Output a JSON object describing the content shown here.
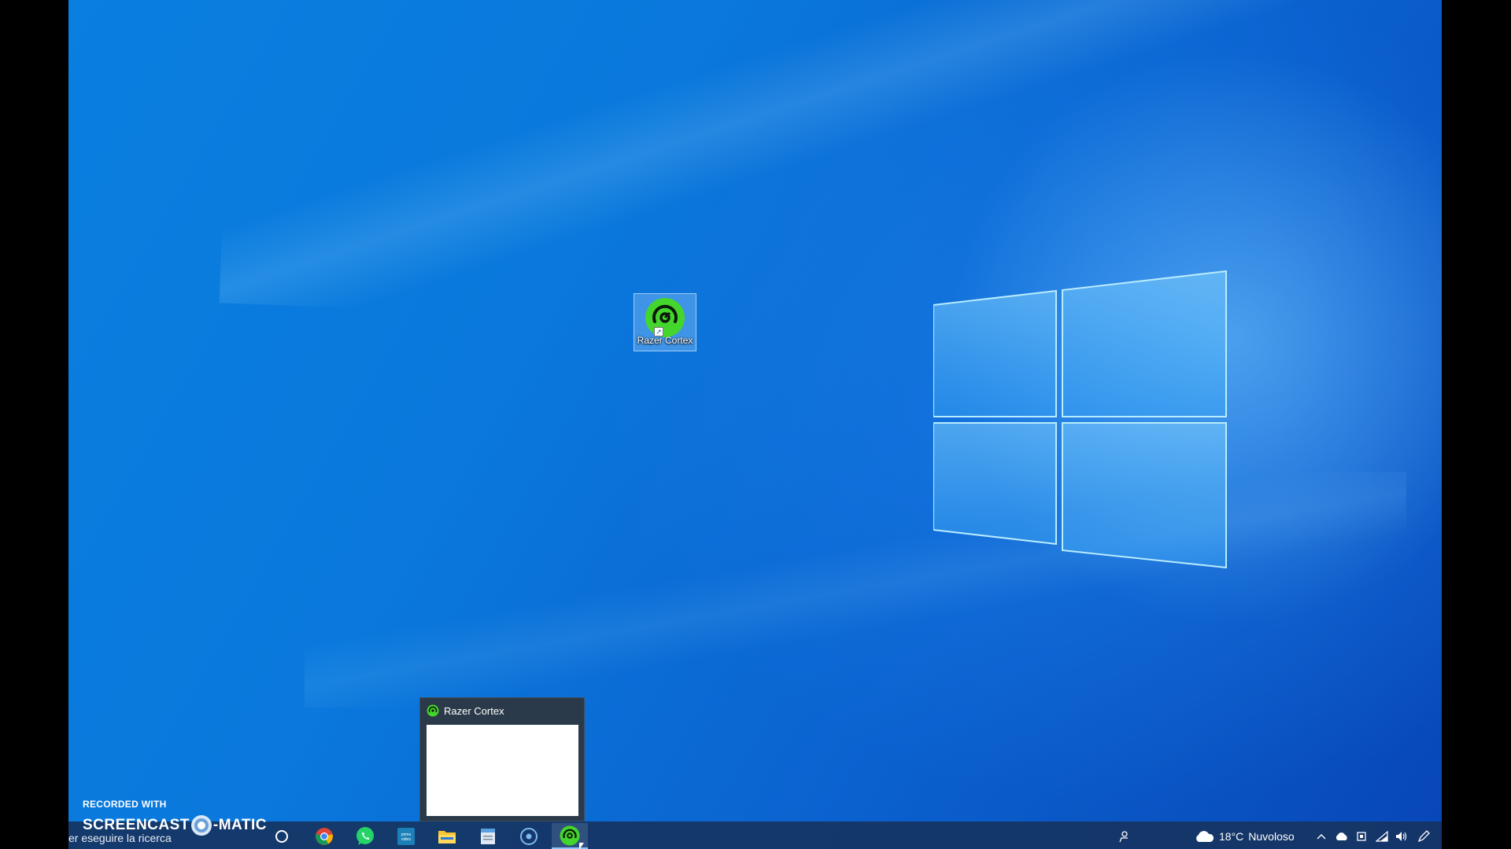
{
  "desktop": {
    "icons": [
      {
        "label": "Razer Cortex",
        "icon": "razer-cortex-icon"
      }
    ]
  },
  "taskbar_preview": {
    "title": "Razer Cortex",
    "icon": "razer-cortex-icon"
  },
  "taskbar": {
    "search_placeholder": "er eseguire la ricerca",
    "pinned": [
      {
        "name": "cortana",
        "icon": "cortana-circle-icon"
      },
      {
        "name": "chrome",
        "icon": "chrome-icon"
      },
      {
        "name": "whatsapp",
        "icon": "whatsapp-icon"
      },
      {
        "name": "prime video",
        "icon": "prime-video-icon"
      },
      {
        "name": "file explorer",
        "icon": "folder-icon"
      },
      {
        "name": "notepad",
        "icon": "notepad-icon"
      },
      {
        "name": "media app",
        "icon": "media-circle-icon"
      },
      {
        "name": "razer cortex",
        "icon": "razer-cortex-icon",
        "active": true
      }
    ],
    "tray": {
      "people": "people-icon",
      "weather": {
        "temp": "18°C",
        "condition": "Nuvoloso",
        "icon": "cloud-icon"
      },
      "icons": [
        "chevron-up-icon",
        "onedrive-icon",
        "meet-icon",
        "network-icon",
        "volume-icon",
        "pen-icon"
      ]
    }
  },
  "watermark": {
    "line1": "RECORDED WITH",
    "brand_left": "SCREENCAST",
    "brand_right": "MATIC"
  },
  "colors": {
    "razer_green": "#44d62c",
    "taskbar": "#16345e",
    "wallpaper": "#0a78dc"
  }
}
